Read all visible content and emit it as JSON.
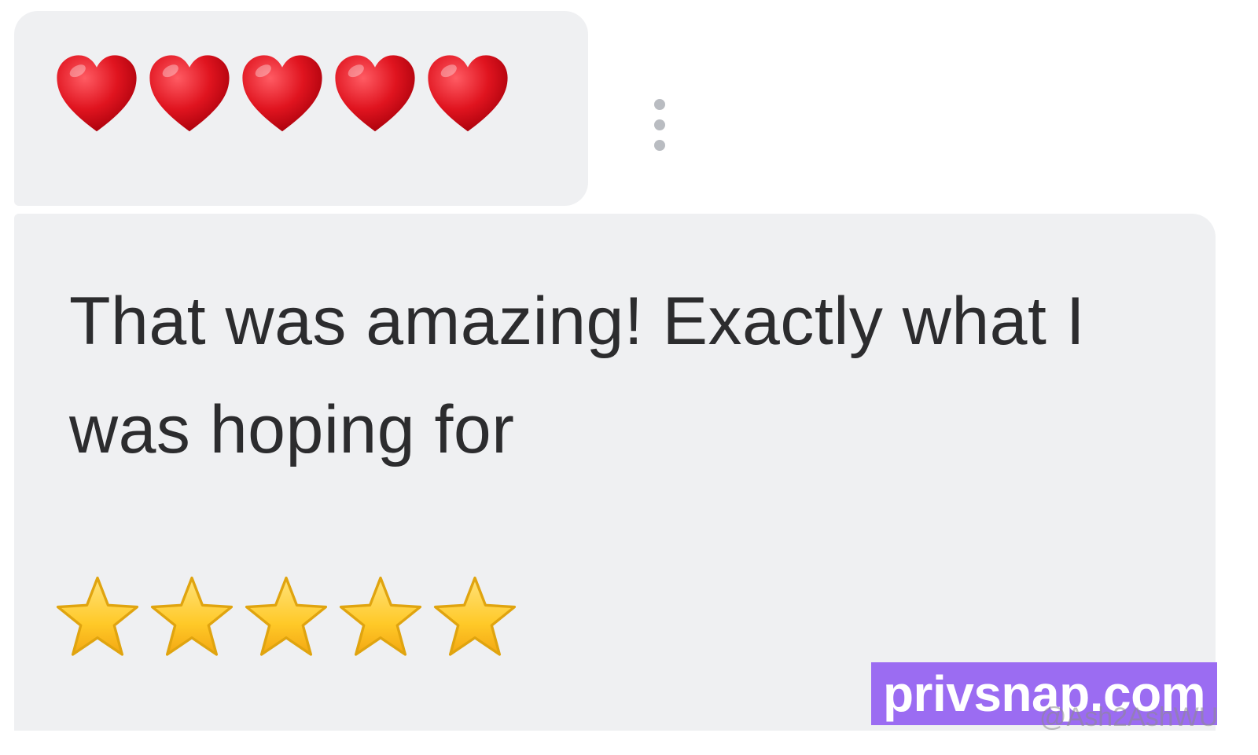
{
  "messages": [
    {
      "type": "emoji",
      "icon": "heart-icon",
      "count": 5,
      "glyph": "❤"
    },
    {
      "type": "text",
      "line1": "That was amazing! Exactly what I",
      "line2": "was hoping for",
      "rating_icon": "star-icon",
      "rating": 5
    }
  ],
  "menu": {
    "icon": "more-vertical-icon"
  },
  "watermark": {
    "text": "privsnap.com",
    "handle": "@Ash2AshWU"
  },
  "colors": {
    "bubble": "#eff0f2",
    "text": "#2c2c2e",
    "heart": "#e0141f",
    "star": "#ffc928",
    "watermark_bg": "#9b6cf2",
    "menu_dots": "#b9bcc1"
  }
}
